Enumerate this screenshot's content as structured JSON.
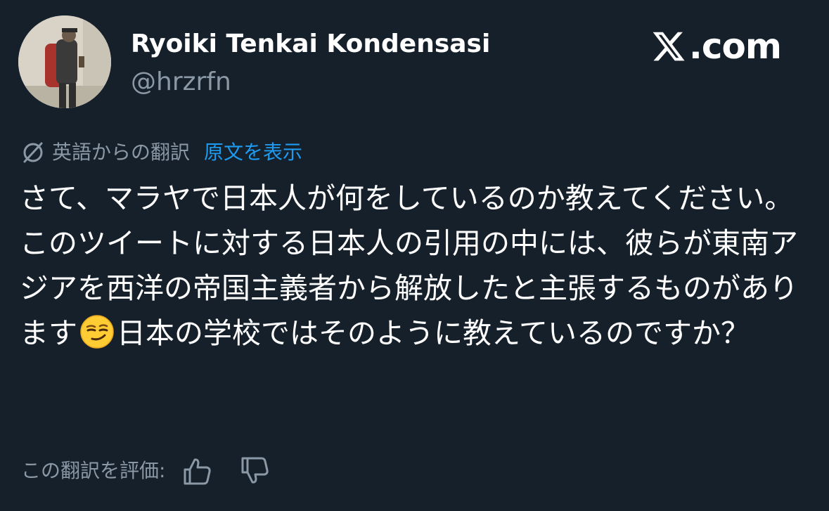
{
  "author": {
    "display_name": "Ryoiki Tenkai Kondensasi",
    "handle": "@hrzrfn"
  },
  "brand": {
    "text": ".com",
    "icon": "x-logo-icon"
  },
  "translation": {
    "translated_from_label": "英語からの翻訳",
    "show_original_label": "原文を表示",
    "icon": "translate-icon"
  },
  "tweet": {
    "text_part1": "さて、マラヤで日本人が何をしているのか教えてください。このツイートに対する日本人の引用の中には、彼らが東南アジアを西洋の帝国主義者から解放したと主張するものがあります",
    "emoji": "smirking-face-emoji",
    "text_part2": "日本の学校ではそのように教えているのですか？"
  },
  "rating": {
    "label": "この翻訳を評価:",
    "thumbs_up_icon": "thumbs-up-icon",
    "thumbs_down_icon": "thumbs-down-icon"
  },
  "colors": {
    "background": "#15202b",
    "primary_text": "#ffffff",
    "secondary_text": "#8b98a5",
    "link": "#1d9bf0"
  }
}
